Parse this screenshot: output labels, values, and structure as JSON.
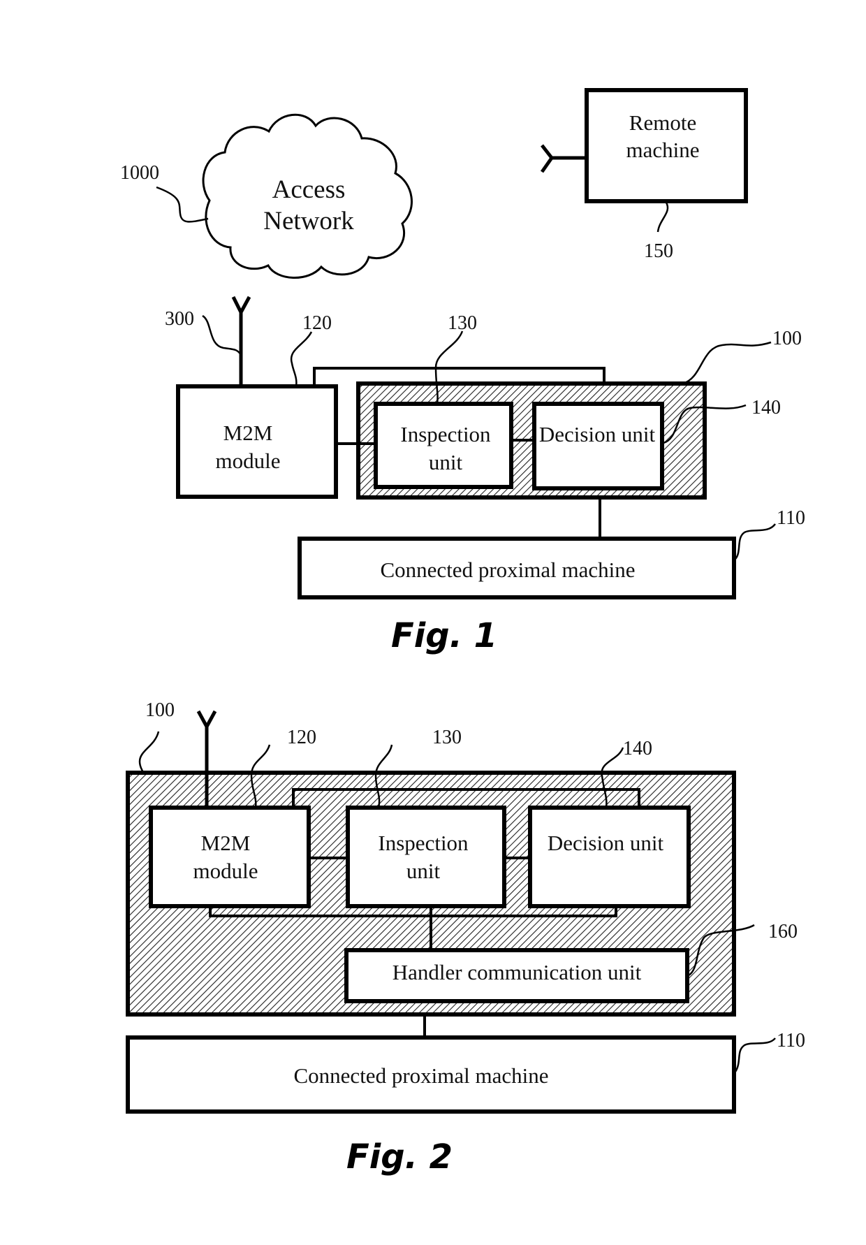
{
  "figures": [
    {
      "caption": "Fig. 1",
      "cloud": {
        "line1": "Access",
        "line2": "Network",
        "ref": "1000"
      },
      "remote_machine": {
        "line1": "Remote",
        "line2": "machine",
        "ref": "150"
      },
      "antenna_ref": "300",
      "device_ref": "100",
      "m2m_module": {
        "line1": "M2M",
        "line2": "module",
        "ref": "120"
      },
      "inspection_unit": {
        "line1": "Inspection",
        "line2": "unit",
        "ref": "130"
      },
      "decision_unit": {
        "label": "Decision unit",
        "ref": "140"
      },
      "connected_machine": {
        "label": "Connected proximal machine",
        "ref": "110"
      }
    },
    {
      "caption": "Fig. 2",
      "device_ref": "100",
      "m2m_module": {
        "line1": "M2M",
        "line2": "module",
        "ref": "120"
      },
      "inspection_unit": {
        "line1": "Inspection",
        "line2": "unit",
        "ref": "130"
      },
      "decision_unit": {
        "label": "Decision unit",
        "ref": "140"
      },
      "handler_unit": {
        "label": "Handler communication unit",
        "ref": "160"
      },
      "connected_machine": {
        "label": "Connected proximal machine",
        "ref": "110"
      }
    }
  ]
}
